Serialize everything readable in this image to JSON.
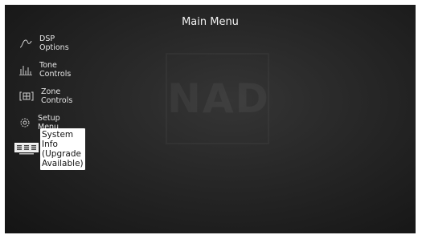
{
  "header": {
    "title": "Main Menu"
  },
  "watermark": {
    "text": "NAD"
  },
  "menu": {
    "items": [
      {
        "label": "DSP Options",
        "icon": "dsp-icon"
      },
      {
        "label": "Tone Controls",
        "icon": "equalizer-icon"
      },
      {
        "label": "Zone Controls",
        "icon": "zone-icon"
      },
      {
        "label": "Setup Menu",
        "icon": "gear-icon"
      },
      {
        "label": "System Info (Upgrade Available)",
        "icon": "system-info-icon",
        "selected": true
      }
    ]
  },
  "colors": {
    "background": "#1e1e1e",
    "text": "#e6e6e6",
    "highlight": "#ffffff"
  }
}
